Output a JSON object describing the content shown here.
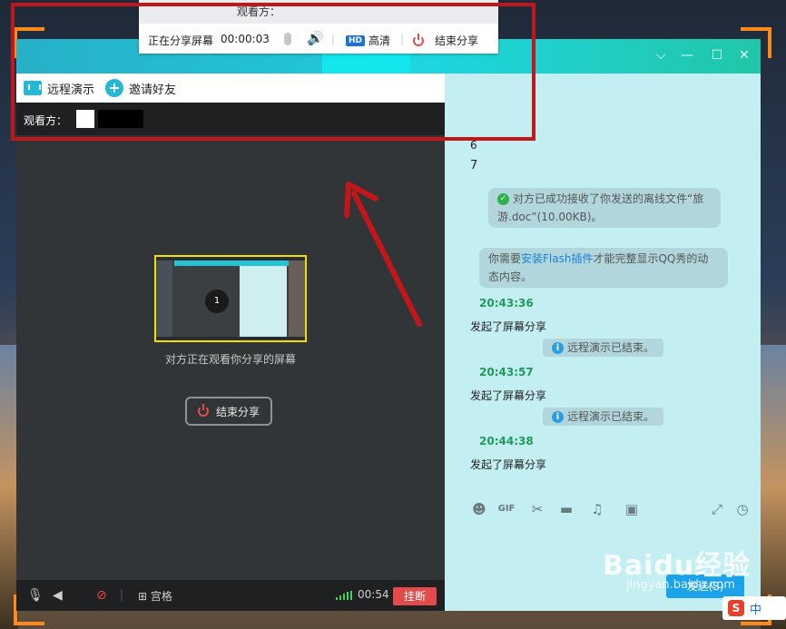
{
  "share_panel": {
    "top_label": "观看方：",
    "status": "正在分享屏幕",
    "timer": "00:00:03",
    "hd_badge": "HD",
    "quality": "高清",
    "end_share": "结束分享"
  },
  "toolbar": {
    "remote_demo": "远程演示",
    "invite_friends": "邀请好友"
  },
  "viewers": {
    "label": "观看方："
  },
  "video": {
    "thumb_number": "1",
    "watching_text": "对方正在观看你分享的屏幕",
    "end_share_button": "结束分享"
  },
  "bottom_bar": {
    "grid_label": "宫格",
    "call_time": "00:54",
    "hangup": "挂断"
  },
  "chat": {
    "partial_top": "6",
    "line_7": "7",
    "file_received": "对方已成功接收了你发送的离线文件“旅游.doc”(10.00KB)。",
    "flash_prefix": "你需要",
    "flash_link": "安装Flash插件",
    "flash_suffix": "才能完整显示QQ秀的动态内容。",
    "entries": [
      {
        "time": "20:43:36",
        "text": "发起了屏幕分享",
        "notice": "远程演示已结束。"
      },
      {
        "time": "20:43:57",
        "text": "发起了屏幕分享",
        "notice": "远程演示已结束。"
      },
      {
        "time": "20:44:38",
        "text": "发起了屏幕分享"
      }
    ],
    "send_button": "发送(S)"
  },
  "watermark": {
    "brand": "Baidu经验",
    "url": "jingyan.baidu.com"
  },
  "ime": {
    "mode": "中"
  },
  "colors": {
    "accent_teal": "#22c4d6",
    "hangup_red": "#e34a4a",
    "annotation_red": "#c2161a",
    "time_green": "#1e9a5a"
  }
}
